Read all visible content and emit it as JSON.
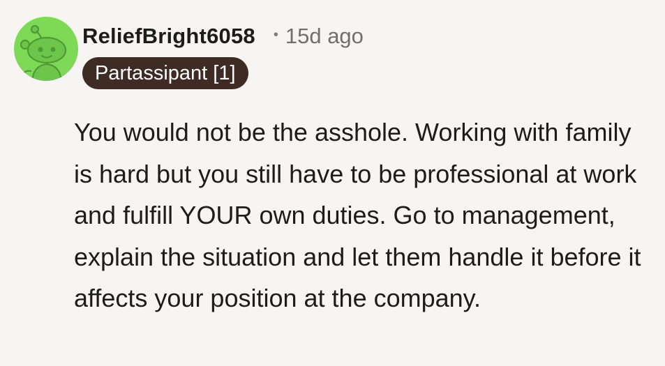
{
  "comment": {
    "author": "ReliefBright6058",
    "separator": "•",
    "timestamp": "15d ago",
    "flair": "Partassipant [1]",
    "avatar_icon": "reddit-snoo-avatar-icon",
    "avatar_color": "#7ed957",
    "flair_color": "#3d2b24",
    "body": "You would not be the asshole. Working with family is hard but you still have to be professional at work and fulfill YOUR own duties. Go to management, explain the situation and let them handle it before it affects your position at the company."
  }
}
